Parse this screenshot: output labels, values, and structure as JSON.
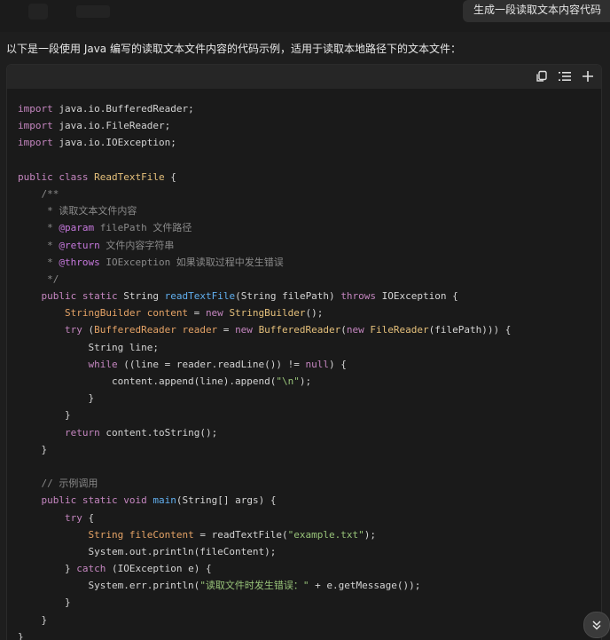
{
  "user_message": "生成一段读取文本内容代码",
  "assistant_intro": "以下是一段使用 Java 编写的读取文本文件内容的代码示例，适用于读取本地路径下的文本文件：",
  "code_toolbar": {
    "copy_icon": "copy-icon",
    "wrap_icon": "list-wrap-icon",
    "expand_icon": "plus-icon"
  },
  "code_language": "java",
  "code_lines": [
    [
      [
        "kw",
        "import"
      ],
      [
        "plain",
        " java.io.BufferedReader;"
      ]
    ],
    [
      [
        "kw",
        "import"
      ],
      [
        "plain",
        " java.io.FileReader;"
      ]
    ],
    [
      [
        "kw",
        "import"
      ],
      [
        "plain",
        " java.io.IOException;"
      ]
    ],
    [],
    [
      [
        "kw",
        "public"
      ],
      [
        "plain",
        " "
      ],
      [
        "kw",
        "class"
      ],
      [
        "plain",
        " "
      ],
      [
        "cls",
        "ReadTextFile"
      ],
      [
        "plain",
        " {"
      ]
    ],
    [
      [
        "com",
        "    /**"
      ]
    ],
    [
      [
        "com",
        "     * 读取文本文件内容"
      ]
    ],
    [
      [
        "com",
        "     * "
      ],
      [
        "tag",
        "@param"
      ],
      [
        "com",
        " filePath 文件路径"
      ]
    ],
    [
      [
        "com",
        "     * "
      ],
      [
        "tag",
        "@return"
      ],
      [
        "com",
        " 文件内容字符串"
      ]
    ],
    [
      [
        "com",
        "     * "
      ],
      [
        "tag",
        "@throws"
      ],
      [
        "com",
        " IOException 如果读取过程中发生错误"
      ]
    ],
    [
      [
        "com",
        "     */"
      ]
    ],
    [
      [
        "plain",
        "    "
      ],
      [
        "kw",
        "public"
      ],
      [
        "plain",
        " "
      ],
      [
        "kw",
        "static"
      ],
      [
        "plain",
        " String "
      ],
      [
        "fn",
        "readTextFile"
      ],
      [
        "plain",
        "(String filePath) "
      ],
      [
        "kw",
        "throws"
      ],
      [
        "plain",
        " IOException {"
      ]
    ],
    [
      [
        "plain",
        "        "
      ],
      [
        "var",
        "StringBuilder content"
      ],
      [
        "plain",
        " = "
      ],
      [
        "kw",
        "new"
      ],
      [
        "plain",
        " "
      ],
      [
        "cls",
        "StringBuilder"
      ],
      [
        "plain",
        "();"
      ]
    ],
    [
      [
        "plain",
        "        "
      ],
      [
        "kw",
        "try"
      ],
      [
        "plain",
        " ("
      ],
      [
        "var",
        "BufferedReader reader"
      ],
      [
        "plain",
        " = "
      ],
      [
        "kw",
        "new"
      ],
      [
        "plain",
        " "
      ],
      [
        "cls",
        "BufferedReader"
      ],
      [
        "plain",
        "("
      ],
      [
        "kw",
        "new"
      ],
      [
        "plain",
        " "
      ],
      [
        "cls",
        "FileReader"
      ],
      [
        "plain",
        "(filePath))) {"
      ]
    ],
    [
      [
        "plain",
        "            String line;"
      ]
    ],
    [
      [
        "plain",
        "            "
      ],
      [
        "kw",
        "while"
      ],
      [
        "plain",
        " ((line = reader.readLine()) != "
      ],
      [
        "kw",
        "null"
      ],
      [
        "plain",
        ") {"
      ]
    ],
    [
      [
        "plain",
        "                content.append(line).append("
      ],
      [
        "str",
        "\"\\n\""
      ],
      [
        "plain",
        ");"
      ]
    ],
    [
      [
        "plain",
        "            }"
      ]
    ],
    [
      [
        "plain",
        "        }"
      ]
    ],
    [
      [
        "plain",
        "        "
      ],
      [
        "kw",
        "return"
      ],
      [
        "plain",
        " content.toString();"
      ]
    ],
    [
      [
        "plain",
        "    }"
      ]
    ],
    [],
    [
      [
        "com",
        "    // 示例调用"
      ]
    ],
    [
      [
        "plain",
        "    "
      ],
      [
        "kw",
        "public"
      ],
      [
        "plain",
        " "
      ],
      [
        "kw",
        "static"
      ],
      [
        "plain",
        " "
      ],
      [
        "kw",
        "void"
      ],
      [
        "plain",
        " "
      ],
      [
        "fn",
        "main"
      ],
      [
        "plain",
        "(String[] args) {"
      ]
    ],
    [
      [
        "plain",
        "        "
      ],
      [
        "kw",
        "try"
      ],
      [
        "plain",
        " {"
      ]
    ],
    [
      [
        "plain",
        "            "
      ],
      [
        "var",
        "String fileContent"
      ],
      [
        "plain",
        " = readTextFile("
      ],
      [
        "str",
        "\"example.txt\""
      ],
      [
        "plain",
        ");"
      ]
    ],
    [
      [
        "plain",
        "            System.out.println(fileContent);"
      ]
    ],
    [
      [
        "plain",
        "        } "
      ],
      [
        "kw",
        "catch"
      ],
      [
        "plain",
        " (IOException e) {"
      ]
    ],
    [
      [
        "plain",
        "            System.err.println("
      ],
      [
        "str",
        "\"读取文件时发生错误：\""
      ],
      [
        "plain",
        " + e.getMessage());"
      ]
    ],
    [
      [
        "plain",
        "        }"
      ]
    ],
    [
      [
        "plain",
        "    }"
      ]
    ],
    [
      [
        "plain",
        "}"
      ]
    ]
  ],
  "scroll_button_icon": "chevrons-down-icon"
}
